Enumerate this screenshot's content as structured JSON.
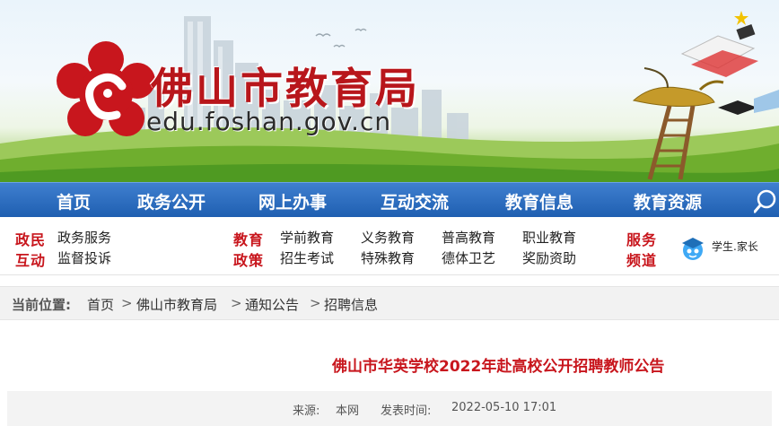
{
  "header": {
    "site_title": "佛山市教育局",
    "domain": "edu.foshan.gov.cn"
  },
  "main_nav": [
    "首页",
    "政务公开",
    "网上办事",
    "互动交流",
    "教育信息",
    "教育资源"
  ],
  "sub_nav": {
    "groups": [
      {
        "label_line1": "政民",
        "label_line2": "互动",
        "links": [
          "政务服务",
          "监督投诉"
        ]
      },
      {
        "label_line1": "教育",
        "label_line2": "政策",
        "links": [
          "学前教育",
          "义务教育",
          "普高教育",
          "职业教育",
          "招生考试",
          "特殊教育",
          "德体卫艺",
          "奖励资助"
        ]
      },
      {
        "label_line1": "服务",
        "label_line2": "频道",
        "links": [
          "学生.家长"
        ]
      }
    ]
  },
  "breadcrumb": {
    "label": "当前位置:",
    "items": [
      "首页",
      "佛山市教育局",
      "通知公告",
      "招聘信息"
    ]
  },
  "article": {
    "title": "佛山市华英学校2022年赴高校公开招聘教师公告",
    "source_label": "来源:",
    "source": "本网",
    "date_label": "发表时间:",
    "date": "2022-05-10 17:01"
  },
  "colors": {
    "accent_red": "#c8161d",
    "nav_blue": "#1f5fb1",
    "breadcrumb_bg": "#f2f2f2"
  },
  "icons": [
    "flower-emblem-icon",
    "search-icon",
    "student-parent-icon"
  ]
}
